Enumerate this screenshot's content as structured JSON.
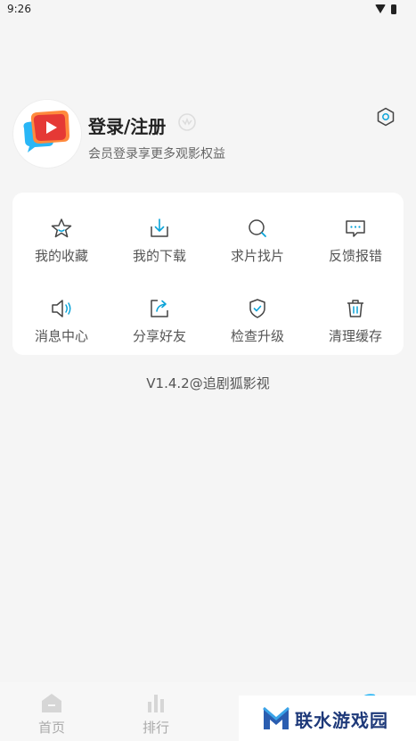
{
  "status_bar": {
    "time": "9:26"
  },
  "profile": {
    "title": "登录/注册",
    "subtitle": "会员登录享更多观影权益"
  },
  "menu": {
    "items": [
      {
        "label": "我的收藏",
        "icon": "star-icon"
      },
      {
        "label": "我的下载",
        "icon": "download-icon"
      },
      {
        "label": "求片找片",
        "icon": "search-icon"
      },
      {
        "label": "反馈报错",
        "icon": "feedback-icon"
      },
      {
        "label": "消息中心",
        "icon": "speaker-icon"
      },
      {
        "label": "分享好友",
        "icon": "share-icon"
      },
      {
        "label": "检查升级",
        "icon": "shield-check-icon"
      },
      {
        "label": "清理缓存",
        "icon": "trash-icon"
      }
    ]
  },
  "version": "V1.4.2@追剧狐影视",
  "tabbar": {
    "tabs": [
      {
        "label": "首页",
        "icon": "home-icon"
      },
      {
        "label": "排行",
        "icon": "ranking-icon"
      },
      {
        "label": "",
        "icon": "tab3-icon"
      },
      {
        "label": "",
        "icon": "tab4-icon"
      }
    ]
  },
  "watermark": {
    "text": "联水游戏园"
  },
  "colors": {
    "accent": "#0aa3d8",
    "brand_red": "#e53935",
    "brand_orange": "#ff8a3d",
    "brand_blue": "#29b6f6"
  }
}
